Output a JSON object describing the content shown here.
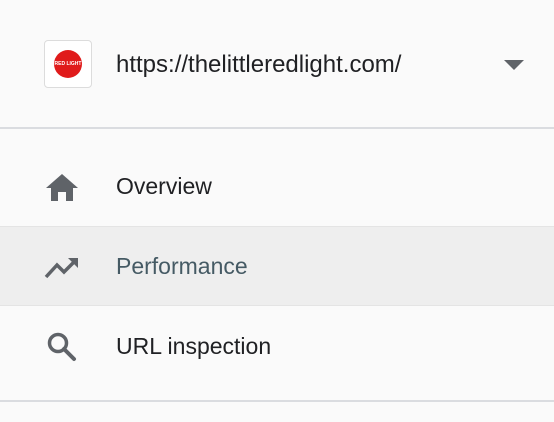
{
  "property": {
    "url": "https://thelittleredlight.com/",
    "favicon_text": "RED LIGHT",
    "favicon_icon": "site-favicon",
    "dropdown_icon": "arrow-drop-down-icon"
  },
  "nav": {
    "items": [
      {
        "label": "Overview",
        "icon": "home-icon",
        "active": false
      },
      {
        "label": "Performance",
        "icon": "trending-up-icon",
        "active": true
      },
      {
        "label": "URL inspection",
        "icon": "search-icon",
        "active": false
      }
    ]
  },
  "colors": {
    "background": "#fafafa",
    "active_background": "#eeeeee",
    "active_text": "#455a64",
    "icon": "#5f6368",
    "favicon_red": "#e01b1b"
  }
}
